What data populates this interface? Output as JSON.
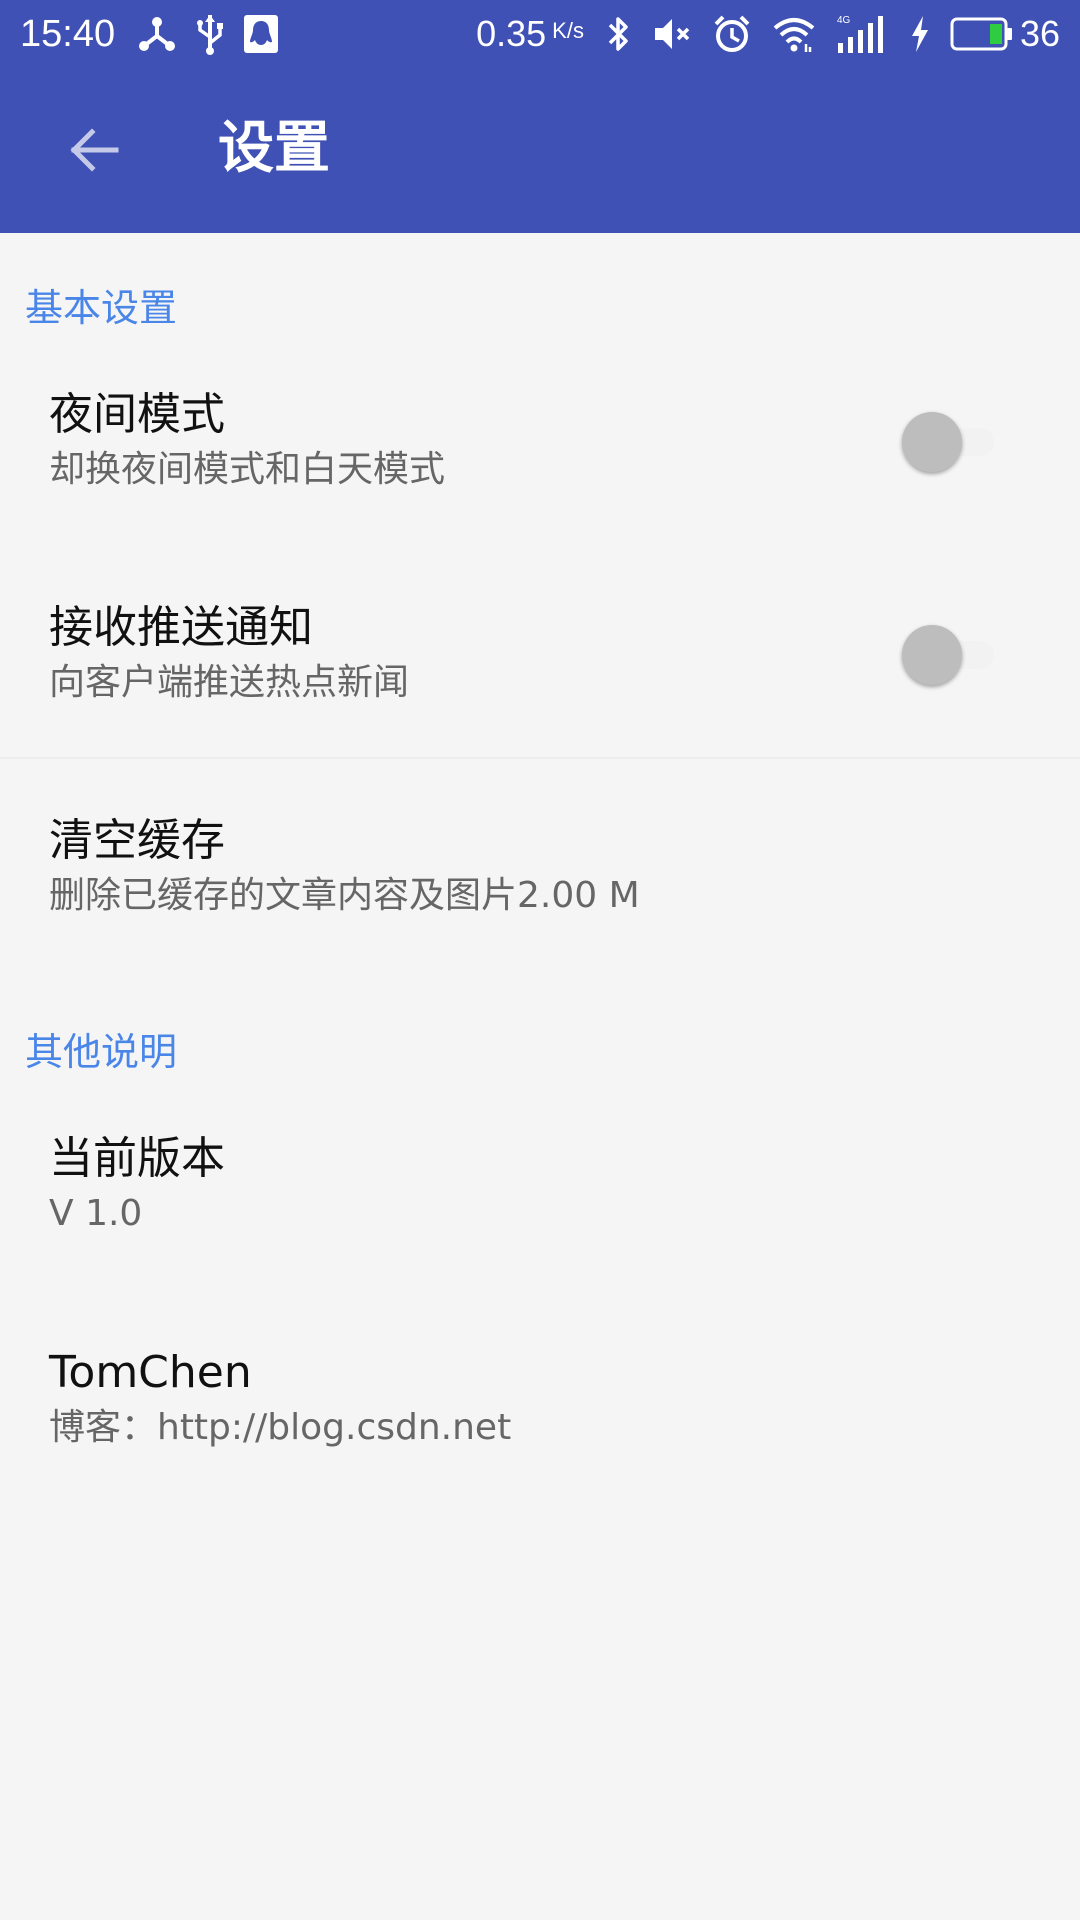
{
  "status_bar": {
    "time": "15:40",
    "left_icons": [
      "usb-connection-icon",
      "usb-icon",
      "qq-notification-icon"
    ],
    "net_speed": "0.35",
    "net_speed_unit": "K/s",
    "right_icons": [
      "bluetooth-icon",
      "mute-icon",
      "alarm-icon",
      "wifi-icon",
      "signal-4g-icon",
      "charging-icon",
      "battery-icon"
    ],
    "battery_level": "36"
  },
  "toolbar": {
    "back_icon": "arrow-back-icon",
    "title": "设置"
  },
  "sections": [
    {
      "title": "基本设置",
      "items": [
        {
          "title": "夜间模式",
          "summary": "却换夜间模式和白天模式",
          "switch": false
        },
        {
          "title": "接收推送通知",
          "summary": "向客户端推送热点新闻",
          "switch": false
        },
        {
          "title": "清空缓存",
          "summary": "删除已缓存的文章内容及图片2.00 M"
        }
      ]
    },
    {
      "title": "其他说明",
      "items": [
        {
          "title": "当前版本",
          "summary": "V 1.0"
        },
        {
          "title": "TomChen",
          "summary": "博客：http://blog.csdn.net"
        }
      ]
    }
  ],
  "colors": {
    "primary": "#3f51b5",
    "accent_category": "#4a86e8",
    "background": "#f5f5f5"
  }
}
